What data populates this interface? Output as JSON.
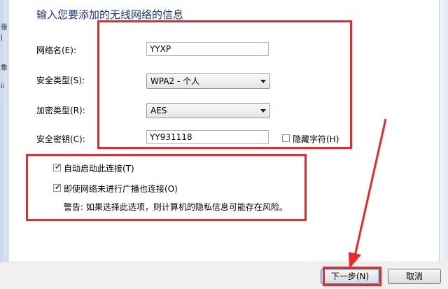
{
  "window": {
    "bg_fragments": [
      "後",
      "j",
      "象",
      "ii"
    ]
  },
  "header": {
    "title": "输入您要添加的无线网络的信息"
  },
  "form": {
    "network_name": {
      "label": "网络名(E):",
      "value": "YYXP"
    },
    "security_type": {
      "label": "安全类型(S):",
      "value": "WPA2 - 个人"
    },
    "encryption_type": {
      "label": "加密类型(R):",
      "value": "AES"
    },
    "security_key": {
      "label": "安全密钥(C):",
      "value": "YY931118"
    },
    "hide_chars": {
      "label": "隐藏字符(H)",
      "checked": false
    }
  },
  "options": {
    "auto_connect": {
      "label": "自动启动此连接(T)",
      "checked": true
    },
    "connect_hidden": {
      "label": "即使网络未进行广播也连接(O)",
      "checked": true
    },
    "warning": "警告: 如果选择此选项，则计算机的隐私信息可能存在风险。"
  },
  "footer": {
    "next_label": "下一步(N)",
    "cancel_label": "取消"
  },
  "colors": {
    "annotation_red": "#ea2a2a",
    "title_blue": "#1e3287"
  }
}
